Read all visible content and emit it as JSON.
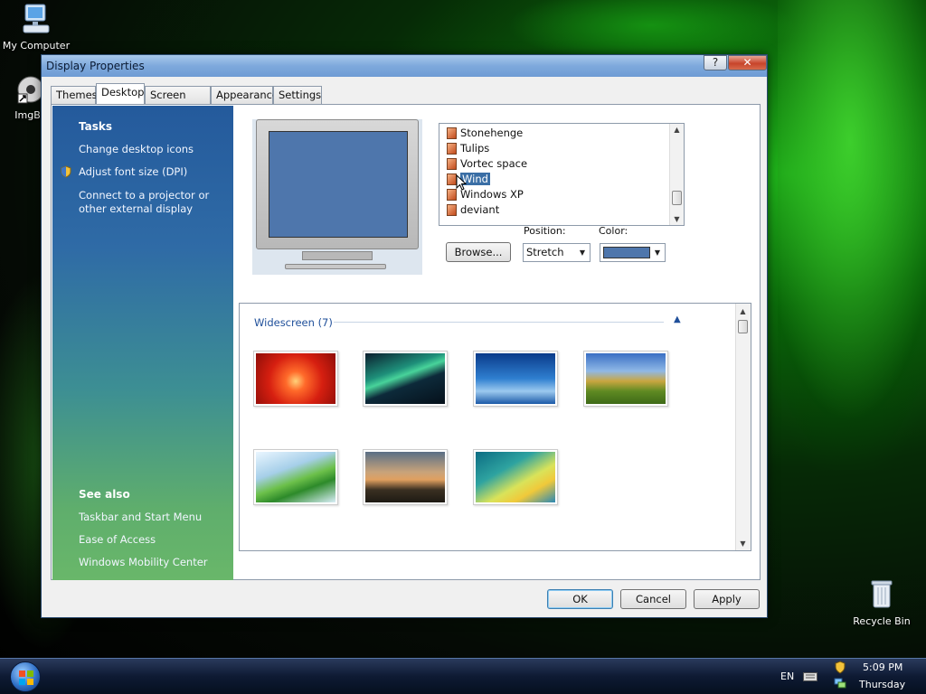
{
  "desktop": {
    "icons": [
      {
        "label": "My Computer"
      },
      {
        "label": "ImgBu"
      },
      {
        "label": "Recycle Bin"
      }
    ]
  },
  "dialog": {
    "title": "Display Properties",
    "help_symbol": "?",
    "close_symbol": "✕",
    "tabs": [
      {
        "label": "Themes"
      },
      {
        "label": "Desktop"
      },
      {
        "label": "Screen Saver"
      },
      {
        "label": "Appearance"
      },
      {
        "label": "Settings"
      }
    ],
    "active_tab": "Desktop",
    "tasks": {
      "heading": "Tasks",
      "links": [
        {
          "label": "Change desktop icons"
        },
        {
          "label": "Adjust font size (DPI)"
        },
        {
          "label": "Connect to a projector or other external display"
        }
      ]
    },
    "see_also": {
      "heading": "See also",
      "links": [
        {
          "label": "Taskbar and Start Menu"
        },
        {
          "label": "Ease of Access"
        },
        {
          "label": "Windows Mobility Center"
        }
      ]
    },
    "background_list": {
      "items": [
        {
          "label": "Stonehenge"
        },
        {
          "label": "Tulips"
        },
        {
          "label": "Vortec space"
        },
        {
          "label": "Wind",
          "selected": true
        },
        {
          "label": "Windows XP"
        },
        {
          "label": "deviant"
        }
      ]
    },
    "browse_label": "Browse...",
    "position_label": "Position:",
    "position_value": "Stretch",
    "color_label": "Color:",
    "color_value": "#4e76ac",
    "gallery": {
      "group_label": "Widescreen (7)",
      "thumbnails": [
        {
          "name": "red-flower"
        },
        {
          "name": "aurora"
        },
        {
          "name": "fish"
        },
        {
          "name": "landscape"
        },
        {
          "name": "palm-leaf"
        },
        {
          "name": "rocks"
        },
        {
          "name": "vista-aurora"
        }
      ]
    },
    "buttons": {
      "ok": "OK",
      "cancel": "Cancel",
      "apply": "Apply"
    }
  },
  "taskbar": {
    "language": "EN",
    "time": "5:09 PM",
    "day": "Thursday"
  }
}
